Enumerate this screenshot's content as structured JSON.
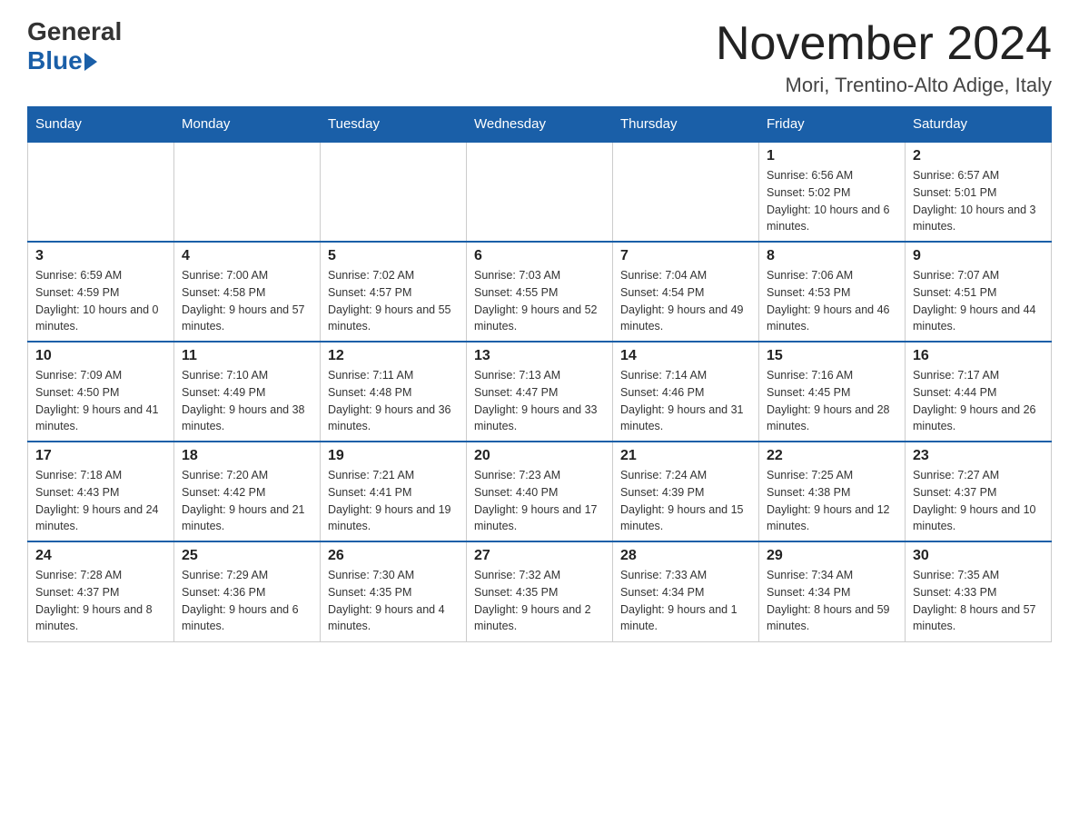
{
  "logo": {
    "general": "General",
    "blue": "Blue"
  },
  "header": {
    "month": "November 2024",
    "location": "Mori, Trentino-Alto Adige, Italy"
  },
  "days_of_week": [
    "Sunday",
    "Monday",
    "Tuesday",
    "Wednesday",
    "Thursday",
    "Friday",
    "Saturday"
  ],
  "weeks": [
    [
      {
        "day": "",
        "info": ""
      },
      {
        "day": "",
        "info": ""
      },
      {
        "day": "",
        "info": ""
      },
      {
        "day": "",
        "info": ""
      },
      {
        "day": "",
        "info": ""
      },
      {
        "day": "1",
        "info": "Sunrise: 6:56 AM\nSunset: 5:02 PM\nDaylight: 10 hours and 6 minutes."
      },
      {
        "day": "2",
        "info": "Sunrise: 6:57 AM\nSunset: 5:01 PM\nDaylight: 10 hours and 3 minutes."
      }
    ],
    [
      {
        "day": "3",
        "info": "Sunrise: 6:59 AM\nSunset: 4:59 PM\nDaylight: 10 hours and 0 minutes."
      },
      {
        "day": "4",
        "info": "Sunrise: 7:00 AM\nSunset: 4:58 PM\nDaylight: 9 hours and 57 minutes."
      },
      {
        "day": "5",
        "info": "Sunrise: 7:02 AM\nSunset: 4:57 PM\nDaylight: 9 hours and 55 minutes."
      },
      {
        "day": "6",
        "info": "Sunrise: 7:03 AM\nSunset: 4:55 PM\nDaylight: 9 hours and 52 minutes."
      },
      {
        "day": "7",
        "info": "Sunrise: 7:04 AM\nSunset: 4:54 PM\nDaylight: 9 hours and 49 minutes."
      },
      {
        "day": "8",
        "info": "Sunrise: 7:06 AM\nSunset: 4:53 PM\nDaylight: 9 hours and 46 minutes."
      },
      {
        "day": "9",
        "info": "Sunrise: 7:07 AM\nSunset: 4:51 PM\nDaylight: 9 hours and 44 minutes."
      }
    ],
    [
      {
        "day": "10",
        "info": "Sunrise: 7:09 AM\nSunset: 4:50 PM\nDaylight: 9 hours and 41 minutes."
      },
      {
        "day": "11",
        "info": "Sunrise: 7:10 AM\nSunset: 4:49 PM\nDaylight: 9 hours and 38 minutes."
      },
      {
        "day": "12",
        "info": "Sunrise: 7:11 AM\nSunset: 4:48 PM\nDaylight: 9 hours and 36 minutes."
      },
      {
        "day": "13",
        "info": "Sunrise: 7:13 AM\nSunset: 4:47 PM\nDaylight: 9 hours and 33 minutes."
      },
      {
        "day": "14",
        "info": "Sunrise: 7:14 AM\nSunset: 4:46 PM\nDaylight: 9 hours and 31 minutes."
      },
      {
        "day": "15",
        "info": "Sunrise: 7:16 AM\nSunset: 4:45 PM\nDaylight: 9 hours and 28 minutes."
      },
      {
        "day": "16",
        "info": "Sunrise: 7:17 AM\nSunset: 4:44 PM\nDaylight: 9 hours and 26 minutes."
      }
    ],
    [
      {
        "day": "17",
        "info": "Sunrise: 7:18 AM\nSunset: 4:43 PM\nDaylight: 9 hours and 24 minutes."
      },
      {
        "day": "18",
        "info": "Sunrise: 7:20 AM\nSunset: 4:42 PM\nDaylight: 9 hours and 21 minutes."
      },
      {
        "day": "19",
        "info": "Sunrise: 7:21 AM\nSunset: 4:41 PM\nDaylight: 9 hours and 19 minutes."
      },
      {
        "day": "20",
        "info": "Sunrise: 7:23 AM\nSunset: 4:40 PM\nDaylight: 9 hours and 17 minutes."
      },
      {
        "day": "21",
        "info": "Sunrise: 7:24 AM\nSunset: 4:39 PM\nDaylight: 9 hours and 15 minutes."
      },
      {
        "day": "22",
        "info": "Sunrise: 7:25 AM\nSunset: 4:38 PM\nDaylight: 9 hours and 12 minutes."
      },
      {
        "day": "23",
        "info": "Sunrise: 7:27 AM\nSunset: 4:37 PM\nDaylight: 9 hours and 10 minutes."
      }
    ],
    [
      {
        "day": "24",
        "info": "Sunrise: 7:28 AM\nSunset: 4:37 PM\nDaylight: 9 hours and 8 minutes."
      },
      {
        "day": "25",
        "info": "Sunrise: 7:29 AM\nSunset: 4:36 PM\nDaylight: 9 hours and 6 minutes."
      },
      {
        "day": "26",
        "info": "Sunrise: 7:30 AM\nSunset: 4:35 PM\nDaylight: 9 hours and 4 minutes."
      },
      {
        "day": "27",
        "info": "Sunrise: 7:32 AM\nSunset: 4:35 PM\nDaylight: 9 hours and 2 minutes."
      },
      {
        "day": "28",
        "info": "Sunrise: 7:33 AM\nSunset: 4:34 PM\nDaylight: 9 hours and 1 minute."
      },
      {
        "day": "29",
        "info": "Sunrise: 7:34 AM\nSunset: 4:34 PM\nDaylight: 8 hours and 59 minutes."
      },
      {
        "day": "30",
        "info": "Sunrise: 7:35 AM\nSunset: 4:33 PM\nDaylight: 8 hours and 57 minutes."
      }
    ]
  ]
}
